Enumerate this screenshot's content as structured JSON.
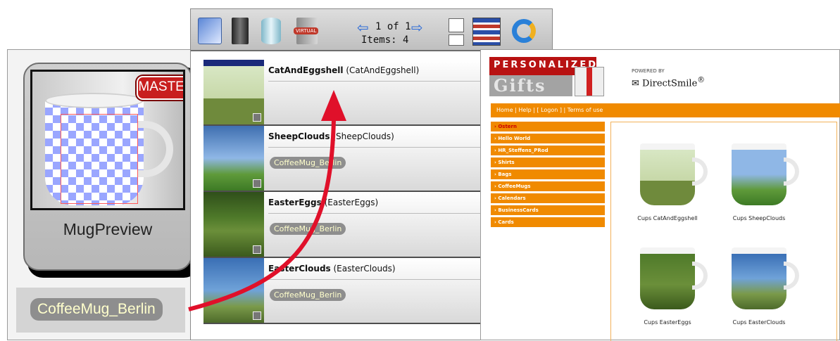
{
  "mug_panel": {
    "badge": "MASTER",
    "title": "MugPreview",
    "source_tag": "CoffeeMug_Berlin"
  },
  "toolbar": {
    "virtual_label": "VIRTUAL",
    "pager": "1 of 1",
    "items": "Items: 4",
    "prev_icon": "arrow-left-icon",
    "next_icon": "arrow-right-icon"
  },
  "list": {
    "rows": [
      {
        "name": "CatAndEggshell",
        "sub": "(CatAndEggshell)",
        "tag": ""
      },
      {
        "name": "SheepClouds",
        "sub": "(SheepClouds)",
        "tag": "CoffeeMug_Berlin"
      },
      {
        "name": "EasterEggs",
        "sub": "(EasterEggs)",
        "tag": "CoffeeMug_Berlin"
      },
      {
        "name": "EasterClouds",
        "sub": "(EasterClouds)",
        "tag": "CoffeeMug_Berlin"
      }
    ]
  },
  "shop": {
    "logo_top": "PERSONALIZED",
    "logo_bottom": "Gifts",
    "powered_by": "POWERED BY",
    "brand": "DirectSmile",
    "nav": "Home | Help | [ Logon ] | Terms of use",
    "categories": [
      "Ostern",
      "Hello World",
      "HR_Steffens_PRod",
      "Shirts",
      "Bags",
      "CoffeeMugs",
      "Calendars",
      "BusinessCards",
      "Cards"
    ],
    "products": [
      "Cups CatAndEggshell",
      "Cups SheepClouds",
      "Cups EasterEggs",
      "Cups EasterClouds"
    ]
  },
  "colors": {
    "accent_orange": "#f08a00",
    "arrow_red": "#e0102a",
    "badge_red": "#c81e1e"
  }
}
